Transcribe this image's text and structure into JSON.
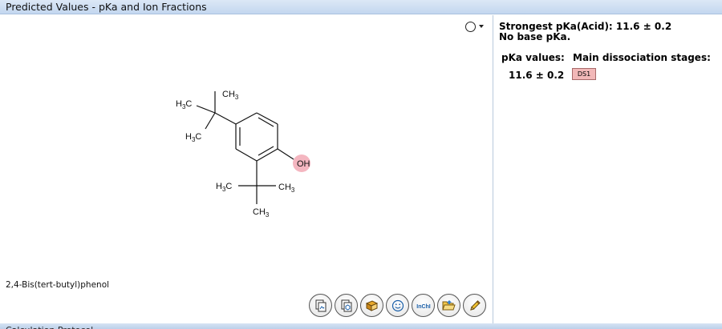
{
  "window": {
    "title": "Predicted Values - pKa and Ion Fractions"
  },
  "structure": {
    "compound_name": "2,4-Bis(tert-butyl)phenol",
    "highlight_color": "#f4b6c0",
    "atom_labels": {
      "oh": "OH",
      "ch3": "CH",
      "h3c": "H",
      "c": "C",
      "sub3": "3"
    }
  },
  "toolbar": {
    "icons": [
      "copy-image-icon",
      "copy-structure-icon",
      "book-icon",
      "smiley-icon",
      "inchi-icon",
      "open-folder-icon",
      "pencil-icon"
    ],
    "inchi_label": "InChI"
  },
  "results": {
    "strongest_acid": "Strongest pKa(Acid): 11.6 ± 0.2",
    "base_note": "No base pKa.",
    "pka_values_header": "pKa values:",
    "stages_header": "Main dissociation stages:",
    "pka_value": "11.6 ± 0.2",
    "stage_badge": "DS1",
    "badge_color": "#f2b8b8"
  },
  "bottom_panel": {
    "title": "Calculation Protocol"
  }
}
